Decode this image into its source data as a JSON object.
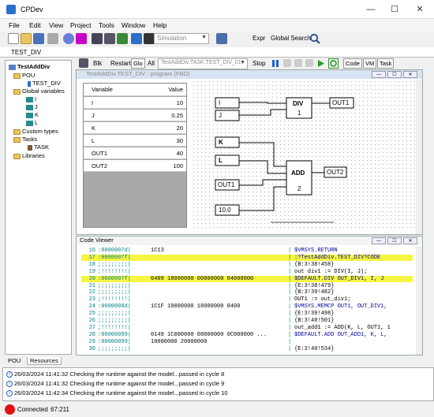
{
  "window": {
    "title": "CPDev",
    "min": "—",
    "max": "☐",
    "close": "✕"
  },
  "menu": [
    "File",
    "Edit",
    "View",
    "Project",
    "Tools",
    "Window",
    "Help"
  ],
  "toolbar": {
    "mode_value": "Simulation",
    "expr_label": "Expr",
    "global_search_label": "Global Search"
  },
  "doc_tab": "TEST_DIV",
  "tree": {
    "root": "TestAddDiv",
    "pou": "POU",
    "pou_item": "TEST_DIV",
    "globals": "Global variables",
    "vars": [
      "I",
      "J",
      "K",
      "L"
    ],
    "custom_types": "Custom types",
    "tasks": "Tasks",
    "task": "TASK",
    "libraries": "Libraries"
  },
  "left_tabs": [
    "POU",
    "Resources"
  ],
  "editor_toolbar": {
    "blk": "Blk",
    "restart": "Restart",
    "glo": "Glo",
    "all": "All",
    "task_combo": "TestAddDiv.TASK.TEST_DIV_01",
    "stop": "Stop",
    "code": "Code",
    "vm": "VM",
    "task": "Task"
  },
  "program_window": {
    "title": "TestAddDiv.TEST_DIV : program (FBD)",
    "table_headers": {
      "name": "Variable",
      "value": "Value"
    },
    "variables": [
      {
        "name": "I",
        "value": "10"
      },
      {
        "name": "J",
        "value": "0.25"
      },
      {
        "name": "K",
        "value": "20"
      },
      {
        "name": "L",
        "value": "30"
      },
      {
        "name": "OUT1",
        "value": "40"
      },
      {
        "name": "OUT2",
        "value": "100"
      }
    ]
  },
  "fbd": {
    "div_block": {
      "name": "DIV",
      "inst": "1"
    },
    "add_block": {
      "name": "ADD",
      "inst": "2"
    },
    "inputs": {
      "i": "I",
      "j": "J",
      "k": "K",
      "l": "L",
      "out1_in": "OUT1",
      "const": "10.0"
    },
    "outputs": {
      "out1": "OUT1",
      "out2": "OUT2"
    }
  },
  "code_viewer": {
    "title": "Code Viewer",
    "rows": [
      {
        "ln": "16",
        "addr": ":0000007d|",
        "hex": "1C13",
        "src": "$VMSYS.RETURN",
        "hl": false,
        "kw": true
      },
      {
        "ln": "17",
        "addr": ":0000007f|",
        "hex": "",
        "src": ":?TestAddDiv.TEST_DIV?CODE",
        "hl": true,
        "kw": true
      },
      {
        "ln": "18",
        "addr": ";;;;;;;;;|",
        "hex": "",
        "src": "{B:3!38!458}",
        "hl": false,
        "kw": false
      },
      {
        "ln": "19",
        "addr": ";!!!!!!!!|",
        "hex": "",
        "src": "out div1 := DIV(I, J);",
        "hl": false,
        "kw": false
      },
      {
        "ln": "20",
        "addr": ":0000007f|",
        "hex": "0409 18000000 00000000 04000000",
        "src": "$DEFAULT.DIV OUT_DIV1, I, J",
        "hl": true,
        "kw": true
      },
      {
        "ln": "21",
        "addr": ";;;;;;;;;|",
        "hex": "",
        "src": "{E:3!38!479}",
        "hl": false,
        "kw": false
      },
      {
        "ln": "22",
        "addr": ";;;;;;;;;|",
        "hex": "",
        "src": "{B:3!39!482}",
        "hl": false,
        "kw": false
      },
      {
        "ln": "23",
        "addr": ";!!!!!!!!|",
        "hex": "",
        "src": "OUT1 := out_div1;",
        "hl": false,
        "kw": false
      },
      {
        "ln": "24",
        "addr": ":0000008d|",
        "hex": "1C1F 10000000 18000000 0400",
        "src": "$VMSYS.MEMCP OUT1, OUT_DIV1,",
        "hl": false,
        "kw": true
      },
      {
        "ln": "25",
        "addr": ";;;;;;;;;|",
        "hex": "",
        "src": "{E:3!39!498}",
        "hl": false,
        "kw": false
      },
      {
        "ln": "26",
        "addr": ";;;;;;;;;|",
        "hex": "",
        "src": "{B:3!40!501}",
        "hl": false,
        "kw": false
      },
      {
        "ln": "27",
        "addr": ";!!!!!!!!|",
        "hex": "",
        "src": "out_add1 := ADD(K, L, OUT1, 1",
        "hl": false,
        "kw": false
      },
      {
        "ln": "28",
        "addr": ":00000099|",
        "hex": "0149 1C000000 08000000 0C000000 ...",
        "src": "$DEFAULT.ADD OUT_ADD1, K, L,",
        "hl": false,
        "kw": true
      },
      {
        "ln": "29",
        "addr": ":00000099|",
        "hex": "10000000 20000000",
        "src": "",
        "hl": false,
        "kw": false
      },
      {
        "ln": "30",
        "addr": ";;;;;;;;;|",
        "hex": "",
        "src": "{E:3!40!534}",
        "hl": false,
        "kw": false
      }
    ]
  },
  "log": [
    "26/03/2024 11:41:32 Checking the runtime against the model...passed in cycle 8",
    "26/03/2024 11:41:32 Checking the runtime against the model...passed in cycle 9",
    "26/03/2024 11:42:34 Checking the runtime against the model...passed in cycle 10"
  ],
  "status": {
    "state": "Connected",
    "pos": "67:211",
    "state_color": "#e01010"
  }
}
